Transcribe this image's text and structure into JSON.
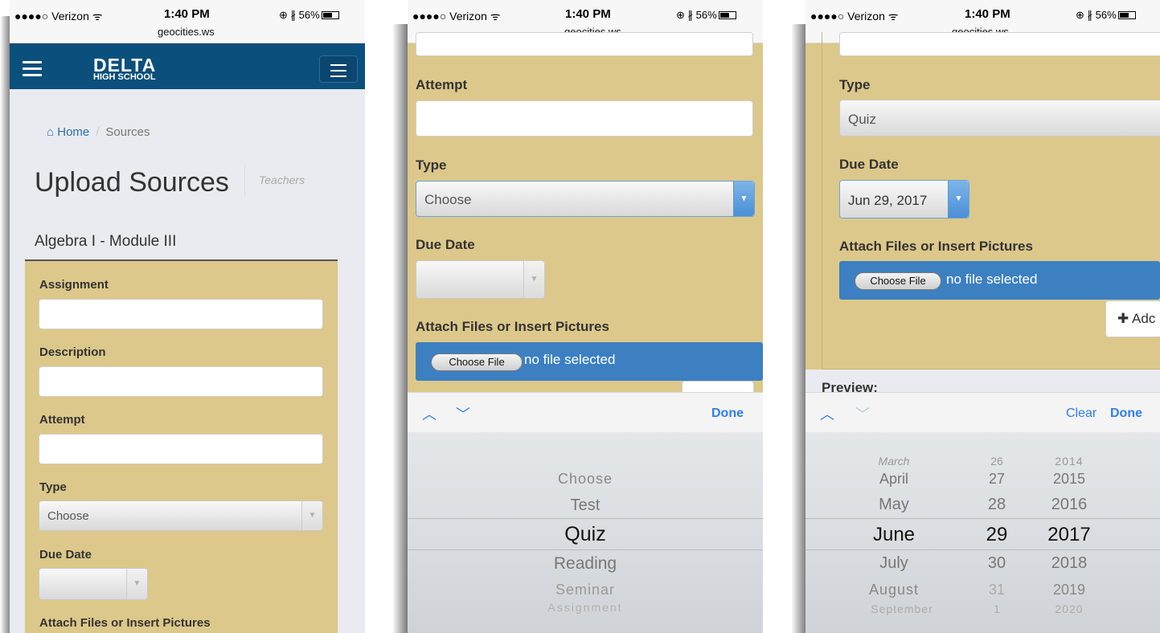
{
  "status_bar": {
    "carrier": "●●●●○ Verizon ᯤ",
    "time": "1:40 PM",
    "url": "geocities.ws",
    "battery": "⊕ ∦ 56%"
  },
  "screen1": {
    "logo_line1": "DELTA",
    "logo_line2": "HIGH SCHOOL",
    "breadcrumb": {
      "home_icon": "⌂",
      "home": "Home",
      "separator": "/",
      "current": "Sources"
    },
    "page_title": "Upload Sources",
    "page_subtitle": "Teachers",
    "section_title": "Algebra I - Module III",
    "form": {
      "assignment_label": "Assignment",
      "description_label": "Description",
      "attempt_label": "Attempt",
      "type_label": "Type",
      "type_value": "Choose",
      "due_date_label": "Due Date",
      "attach_label": "Attach Files or Insert Pictures"
    }
  },
  "screen2": {
    "attempt_label": "Attempt",
    "type_label": "Type",
    "type_value": "Choose",
    "due_date_label": "Due Date",
    "attach_label": "Attach Files or Insert Pictures",
    "choose_file": "Choose File",
    "no_file": "no file selected",
    "picker_done": "Done",
    "picker_items": [
      "Choose",
      "Test",
      "Quiz",
      "Reading",
      "Seminar",
      "Assignment"
    ],
    "picker_selected": "Quiz"
  },
  "screen3": {
    "type_label": "Type",
    "type_value": "Quiz",
    "due_date_label": "Due Date",
    "due_date_value": "Jun 29, 2017",
    "attach_label": "Attach Files or Insert Pictures",
    "choose_file": "Choose File",
    "no_file": "no file selected",
    "add_label": "✚ Adc",
    "preview_label": "Preview:",
    "picker_clear": "Clear",
    "picker_done": "Done",
    "months": [
      "March",
      "April",
      "May",
      "June",
      "July",
      "August",
      "September"
    ],
    "days": [
      "26",
      "27",
      "28",
      "29",
      "30",
      "31",
      "1"
    ],
    "years": [
      "2014",
      "2015",
      "2016",
      "2017",
      "2018",
      "2019",
      "2020"
    ],
    "selected": {
      "month": "June",
      "day": "29",
      "year": "2017"
    }
  },
  "colors": {
    "navbar": "#0b4f7c",
    "panel": "#dcc88a",
    "file_bar": "#3c80c2",
    "ios_blue": "#2f7ff0"
  },
  "icons": {
    "menu": "hamburger-icon",
    "navbar_toggle": "navbar-toggle-icon",
    "home": "home-icon",
    "chevron_up": "chevron-up-icon",
    "chevron_down": "chevron-down-icon",
    "select_arrow": "caret-down-icon"
  }
}
